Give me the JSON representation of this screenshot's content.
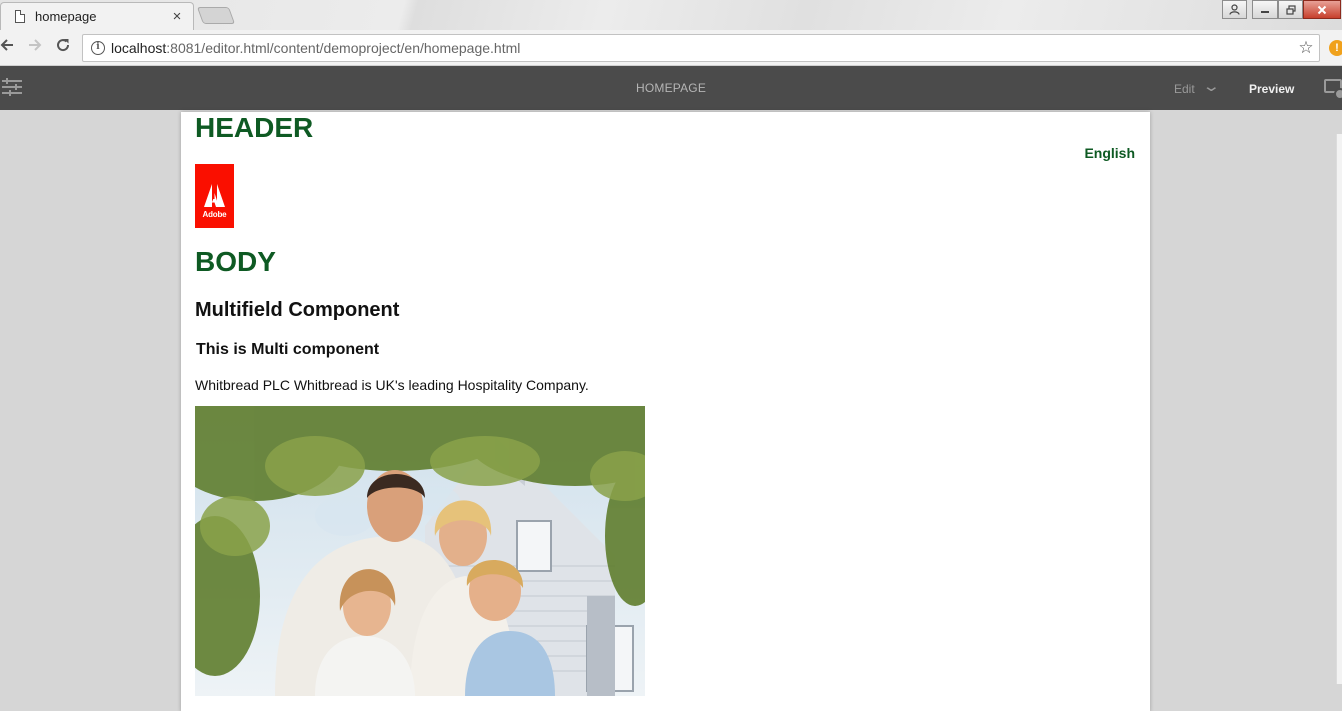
{
  "browser": {
    "tab_title": "homepage",
    "tab_close": "×",
    "url_host": "localhost",
    "url_rest": ":8081/editor.html/content/demoproject/en/homepage.html",
    "ext_badge": "!"
  },
  "editor": {
    "page_name": "HOMEPAGE",
    "mode_label": "Edit",
    "preview_label": "Preview"
  },
  "page": {
    "header_title": "HEADER",
    "language_link": "English",
    "logo_text": "Adobe",
    "body_title": "BODY",
    "component_title": "Multifield Component",
    "component_subtitle": "This is Multi component",
    "component_text": "Whitbread PLC Whitbread is UK's leading Hospitality Company."
  },
  "colors": {
    "heading_green": "#0e5a23",
    "editor_bar": "#4b4b4b",
    "adobe_red": "#fa0f00"
  },
  "icons": [
    "page-icon",
    "tab-close-icon",
    "back-arrow-icon",
    "forward-arrow-icon",
    "reload-icon",
    "info-icon",
    "star-icon",
    "sidepanel-toggle-icon",
    "chevron-down-icon",
    "annotation-icon"
  ]
}
